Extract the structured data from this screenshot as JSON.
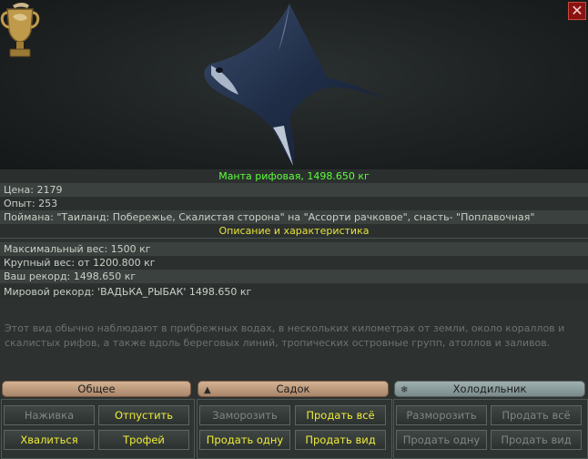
{
  "window": {
    "close_label": "✕"
  },
  "fish": {
    "title": "Манта рифовая, 1498.650 кг",
    "price": "Цена: 2179",
    "experience": "Опыт: 253",
    "caught": "Поймана: \"Таиланд: Побережье, Скалистая сторона\" на \"Ассорти рачковое\", снасть- \"Поплавочная\"",
    "section_title": "Описание и характеристика",
    "max_weight": "Максимальный вес: 1500 кг",
    "large_weight": "Крупный вес: от 1200.800 кг",
    "your_record": "Ваш рекорд: 1498.650 кг",
    "world_record": "Мировой рекорд: 'ВАДЬКА_РЫБАК' 1498.650 кг",
    "description": "Этот вид обычно наблюдают в прибрежных водах, в нескольких километрах от земли, около кораллов и скалистых рифов, а также вдоль береговых линий, тропических островные групп, атоллов и заливов."
  },
  "tabs": {
    "general": "Общее",
    "keepnet": "Садок",
    "fridge": "Холодильник"
  },
  "buttons": {
    "bait": "Наживка",
    "release": "Отпустить",
    "brag": "Хвалиться",
    "trophy": "Трофей",
    "freeze": "Заморозить",
    "sell_all": "Продать всё",
    "sell_one": "Продать одну",
    "sell_kind": "Продать вид",
    "defrost": "Разморозить",
    "sell_all_fridge": "Продать всё",
    "sell_one_fridge": "Продать одну",
    "sell_kind_fridge": "Продать вид"
  }
}
